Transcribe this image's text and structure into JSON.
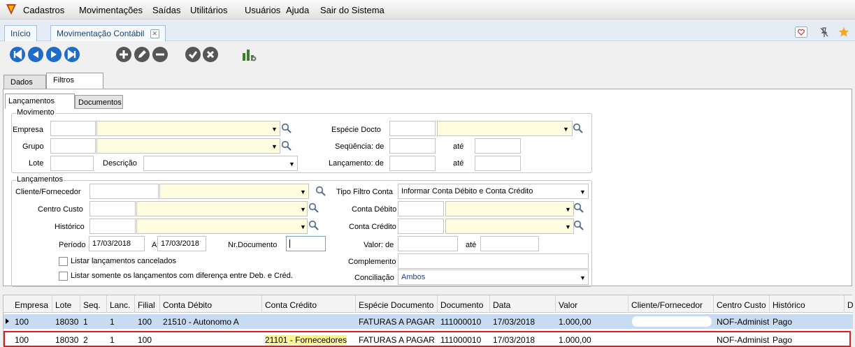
{
  "menu": {
    "items": [
      "Cadastros",
      "Movimentações",
      "Saídas",
      "Utilitários",
      "Usuários",
      "Ajuda",
      "Sair do Sistema"
    ]
  },
  "tabs": {
    "home": "Início",
    "active": "Movimentação Contábil",
    "close_glyph": "✕"
  },
  "icons": {
    "toolbar": [
      "first-record-icon",
      "previous-record-icon",
      "next-record-icon",
      "last-record-icon",
      "add-icon",
      "edit-icon",
      "delete-icon",
      "confirm-icon",
      "cancel-icon",
      "report-chart-icon"
    ],
    "top_right": [
      "heart-icon",
      "unpin-icon",
      "star-icon"
    ]
  },
  "colors": {
    "toolbar_blue": "#1e6cc8",
    "toolbar_gray": "#555555",
    "highlight_row": "#c7dcf3",
    "selection_box": "#e51a1a",
    "yellow_field": "#fffde0",
    "star": "#f5a623"
  },
  "view_tabs": {
    "dados": "Dados",
    "filtros": "Filtros"
  },
  "sub_tabs": {
    "lancamentos": "Lançamentos",
    "documentos": "Documentos"
  },
  "movimento": {
    "legend": "Movimento",
    "empresa": "Empresa",
    "grupo": "Grupo",
    "lote": "Lote",
    "descricao": "Descrição",
    "especie_docto": "Espécie Docto",
    "sequencia_de": "Seqüência: de",
    "lancamento_de": "Lançamento: de",
    "ate": "até"
  },
  "lancamentos": {
    "legend": "Lançamentos",
    "cliente_fornecedor": "Cliente/Fornecedor",
    "centro_custo": "Centro Custo",
    "historico": "Histórico",
    "periodo": "Período",
    "periodo_de": "17/03/2018",
    "ate_label": "Até",
    "periodo_ate": "17/03/2018",
    "nr_documento": "Nr.Documento",
    "listar_cancelados": "Listar lançamentos cancelados",
    "listar_diferenca": "Listar somente os lançamentos com diferença entre Deb. e Créd.",
    "tipo_filtro_conta": "Tipo Filtro Conta",
    "tipo_filtro_value": "Informar Conta Débito e Conta Crédito",
    "conta_debito": "Conta Débito",
    "conta_credito": "Conta Crédito",
    "valor_de": "Valor: de",
    "ate": "até",
    "complemento": "Complemento",
    "conciliacao": "Conciliação",
    "conciliacao_value": "Ambos"
  },
  "grid": {
    "columns": [
      "Empresa",
      "Lote",
      "Seq.",
      "Lanc.",
      "Filial",
      "Conta Débito",
      "Conta Crédito",
      "Espécie Documento",
      "Documento",
      "Data",
      "Valor",
      "Cliente/Fornecedor",
      "Centro Custo",
      "Histórico",
      "D"
    ],
    "rows": [
      [
        "100",
        "18030",
        "1",
        "1",
        "100",
        "21510 - Autonomo A",
        "",
        "FATURAS A PAGAR",
        "111000010",
        "17/03/2018",
        "1.000,00",
        "",
        "NOF-Administr",
        "Pago"
      ],
      [
        "100",
        "18030",
        "2",
        "1",
        "100",
        "",
        "21101 - Fornecedores",
        "FATURAS A PAGAR",
        "111000010",
        "17/03/2018",
        "1.000,00",
        "",
        "NOF-Administr",
        "Pago"
      ]
    ]
  }
}
